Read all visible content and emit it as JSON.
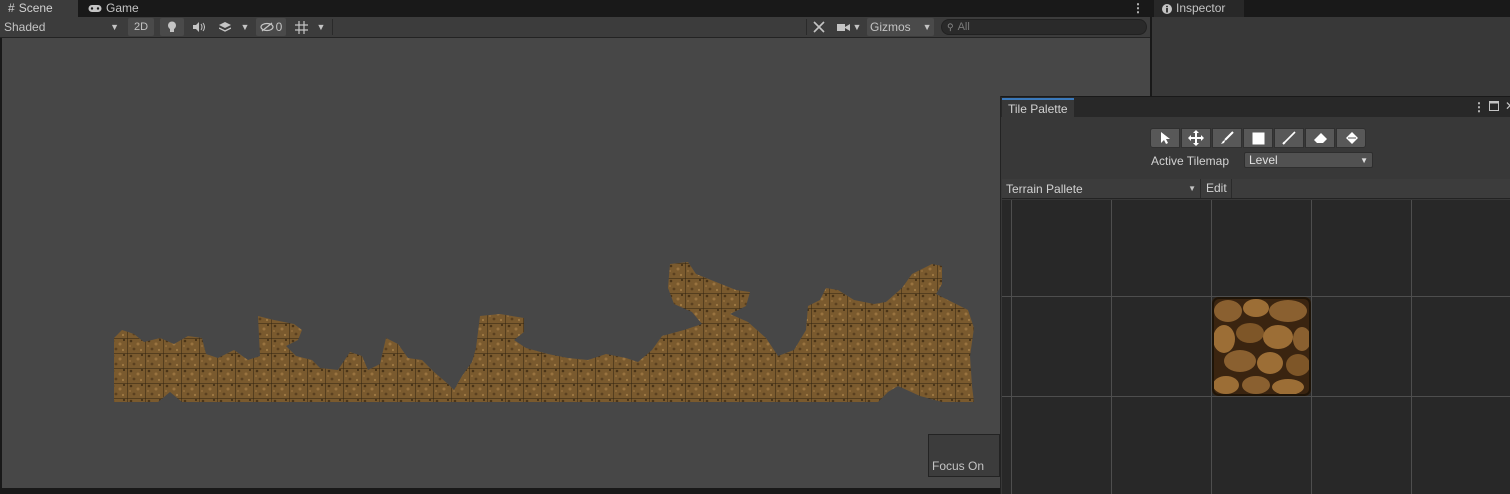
{
  "scene_tabs": [
    {
      "label": "Scene",
      "icon": "grid-icon"
    },
    {
      "label": "Game",
      "icon": "gamepad-icon"
    }
  ],
  "inspector_tab": {
    "label": "Inspector",
    "icon": "info-icon"
  },
  "toolbar": {
    "shading_mode": "Shaded",
    "mode_2d": "2D",
    "hidden_count": "0",
    "gizmos_label": "Gizmos",
    "search_placeholder": "All"
  },
  "tile_palette": {
    "tab_label": "Tile Palette",
    "tools": [
      "select-tool-icon",
      "move-tool-icon",
      "paint-brush-icon",
      "box-fill-icon",
      "picker-icon",
      "eraser-icon",
      "fill-bucket-icon"
    ],
    "active_tilemap_label": "Active Tilemap",
    "active_tilemap_value": "Level",
    "palette_value": "Terrain Pallete",
    "edit_label": "Edit"
  },
  "overlay": {
    "focus_on_label": "Focus On"
  },
  "colors": {
    "accent": "#3a79bb",
    "terrain": "#7a5a2e",
    "scene_bg": "#474747"
  }
}
